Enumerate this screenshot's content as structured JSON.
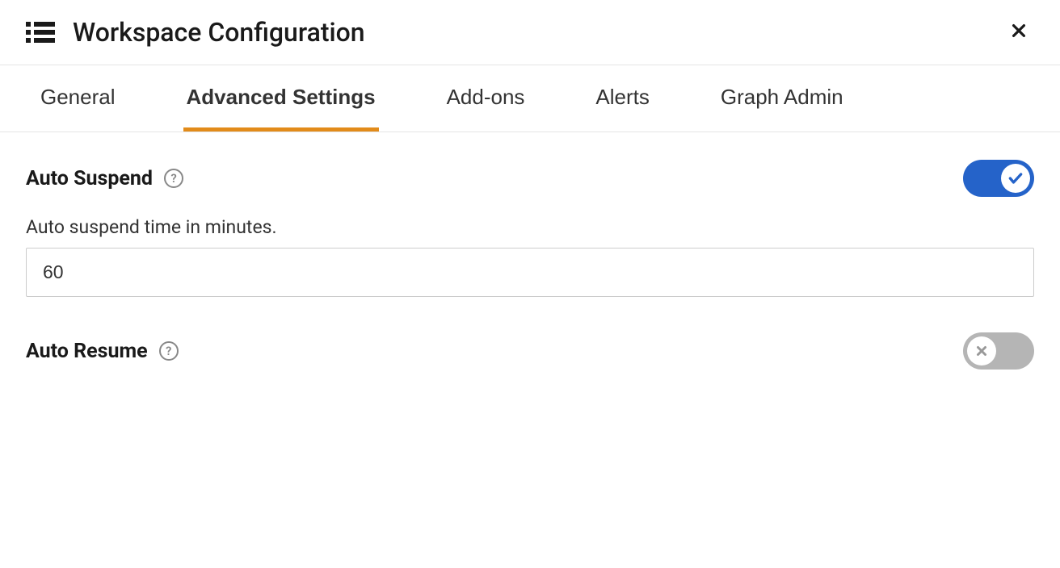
{
  "header": {
    "title": "Workspace Configuration"
  },
  "tabs": [
    {
      "label": "General",
      "active": false
    },
    {
      "label": "Advanced Settings",
      "active": true
    },
    {
      "label": "Add-ons",
      "active": false
    },
    {
      "label": "Alerts",
      "active": false
    },
    {
      "label": "Graph Admin",
      "active": false
    }
  ],
  "settings": {
    "auto_suspend": {
      "label": "Auto Suspend",
      "enabled": true,
      "field_label": "Auto suspend time in minutes.",
      "value": "60"
    },
    "auto_resume": {
      "label": "Auto Resume",
      "enabled": false
    }
  }
}
